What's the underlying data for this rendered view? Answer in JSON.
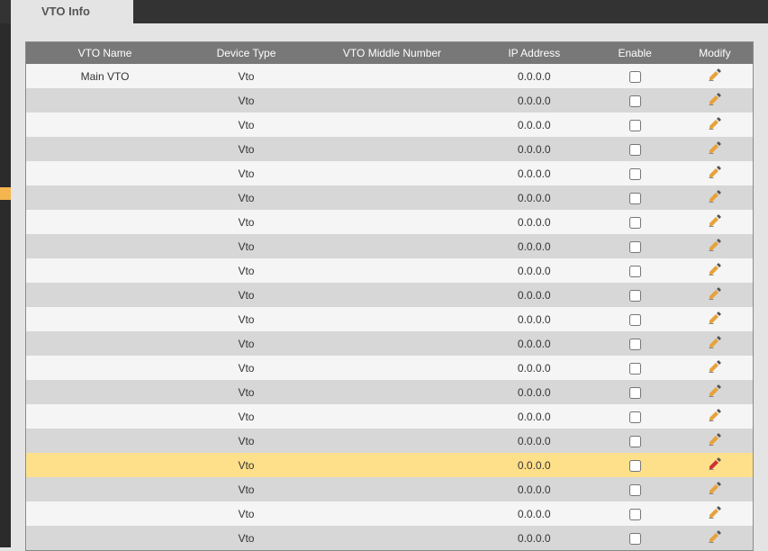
{
  "tab_label": "VTO Info",
  "columns": {
    "name": "VTO Name",
    "type": "Device Type",
    "mid": "VTO Middle Number",
    "ip": "IP Address",
    "enable": "Enable",
    "modify": "Modify"
  },
  "rows": [
    {
      "name": "Main VTO",
      "type": "Vto",
      "mid": "",
      "ip": "0.0.0.0",
      "enable": false,
      "highlight": false
    },
    {
      "name": "",
      "type": "Vto",
      "mid": "",
      "ip": "0.0.0.0",
      "enable": false,
      "highlight": false
    },
    {
      "name": "",
      "type": "Vto",
      "mid": "",
      "ip": "0.0.0.0",
      "enable": false,
      "highlight": false
    },
    {
      "name": "",
      "type": "Vto",
      "mid": "",
      "ip": "0.0.0.0",
      "enable": false,
      "highlight": false
    },
    {
      "name": "",
      "type": "Vto",
      "mid": "",
      "ip": "0.0.0.0",
      "enable": false,
      "highlight": false
    },
    {
      "name": "",
      "type": "Vto",
      "mid": "",
      "ip": "0.0.0.0",
      "enable": false,
      "highlight": false
    },
    {
      "name": "",
      "type": "Vto",
      "mid": "",
      "ip": "0.0.0.0",
      "enable": false,
      "highlight": false
    },
    {
      "name": "",
      "type": "Vto",
      "mid": "",
      "ip": "0.0.0.0",
      "enable": false,
      "highlight": false
    },
    {
      "name": "",
      "type": "Vto",
      "mid": "",
      "ip": "0.0.0.0",
      "enable": false,
      "highlight": false
    },
    {
      "name": "",
      "type": "Vto",
      "mid": "",
      "ip": "0.0.0.0",
      "enable": false,
      "highlight": false
    },
    {
      "name": "",
      "type": "Vto",
      "mid": "",
      "ip": "0.0.0.0",
      "enable": false,
      "highlight": false
    },
    {
      "name": "",
      "type": "Vto",
      "mid": "",
      "ip": "0.0.0.0",
      "enable": false,
      "highlight": false
    },
    {
      "name": "",
      "type": "Vto",
      "mid": "",
      "ip": "0.0.0.0",
      "enable": false,
      "highlight": false
    },
    {
      "name": "",
      "type": "Vto",
      "mid": "",
      "ip": "0.0.0.0",
      "enable": false,
      "highlight": false
    },
    {
      "name": "",
      "type": "Vto",
      "mid": "",
      "ip": "0.0.0.0",
      "enable": false,
      "highlight": false
    },
    {
      "name": "",
      "type": "Vto",
      "mid": "",
      "ip": "0.0.0.0",
      "enable": false,
      "highlight": false
    },
    {
      "name": "",
      "type": "Vto",
      "mid": "",
      "ip": "0.0.0.0",
      "enable": false,
      "highlight": true
    },
    {
      "name": "",
      "type": "Vto",
      "mid": "",
      "ip": "0.0.0.0",
      "enable": false,
      "highlight": false
    },
    {
      "name": "",
      "type": "Vto",
      "mid": "",
      "ip": "0.0.0.0",
      "enable": false,
      "highlight": false
    },
    {
      "name": "",
      "type": "Vto",
      "mid": "",
      "ip": "0.0.0.0",
      "enable": false,
      "highlight": false
    }
  ]
}
